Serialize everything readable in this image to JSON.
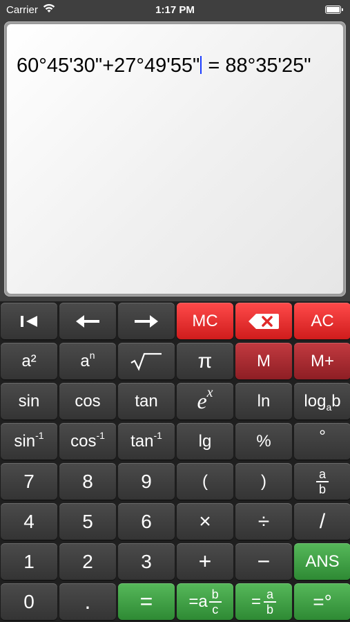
{
  "status": {
    "carrier": "Carrier",
    "time": "1:17 PM"
  },
  "display": {
    "expr_before_cursor": "60°45'30\"+27°49'55\"",
    "expr_after_cursor": " = 88°35'25\""
  },
  "keys": {
    "mc": "MC",
    "ac": "AC",
    "a_base": "a",
    "sq_exp": "²",
    "pow_exp": "n",
    "pi": "π",
    "m": "M",
    "mplus": "M+",
    "sin": "sin",
    "cos": "cos",
    "tan": "tan",
    "e_base": "e",
    "e_exp": "x",
    "ln": "ln",
    "log": "log",
    "log_a": "a",
    "log_b": "b",
    "inv_exp": "-1",
    "lg": "lg",
    "percent": "%",
    "degree": "°",
    "d7": "7",
    "d8": "8",
    "d9": "9",
    "lparen": "(",
    "rparen": ")",
    "frac_a": "a",
    "frac_b": "b",
    "d4": "4",
    "d5": "5",
    "d6": "6",
    "times": "×",
    "divide": "÷",
    "slash": "/",
    "d1": "1",
    "d2": "2",
    "d3": "3",
    "plus": "+",
    "minus": "−",
    "ans": "ANS",
    "d0": "0",
    "dot": ".",
    "equals": "=",
    "eq_mixed_prefix": "=a",
    "eq_mixed_num": "b",
    "eq_mixed_den": "c",
    "eq_frac_prefix": "=",
    "eq_frac_num": "a",
    "eq_frac_den": "b",
    "eq_deg": "=°"
  },
  "colors": {
    "key_dark": "#404040",
    "key_red": "#e83030",
    "key_darkred": "#a82a30",
    "key_green": "#42a046",
    "cursor": "#1a3cff"
  }
}
